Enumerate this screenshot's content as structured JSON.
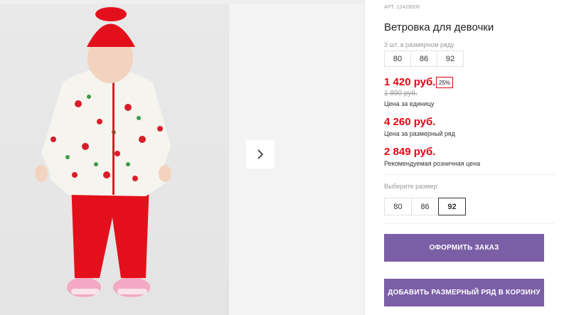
{
  "gallery": {
    "next_icon": "chevron-right-icon"
  },
  "product": {
    "article": "АРТ. 12429006",
    "title": "Ветровка для девочки",
    "row_note": "3 шт. в размерном ряду",
    "row_sizes": [
      "80",
      "86",
      "92"
    ],
    "price": "1 420 руб.",
    "discount": "25%",
    "old_price": "1 890 руб.",
    "price_caption": "Цена за единицу",
    "row_price": "4 260 руб.",
    "row_price_caption": "Цена за размерный ряд",
    "retail_price": "2 849 руб.",
    "retail_caption": "Рекомендуемая розничная цена",
    "choose_size": "Выберите размер:",
    "size_options": [
      "80",
      "86",
      "92"
    ],
    "selected_size": "92"
  },
  "actions": {
    "order_label": "Оформить заказ",
    "add_row_label": "Добавить размерный ряд в корзину"
  },
  "colors": {
    "accent": "#7b5fa6",
    "price": "#e30613"
  }
}
